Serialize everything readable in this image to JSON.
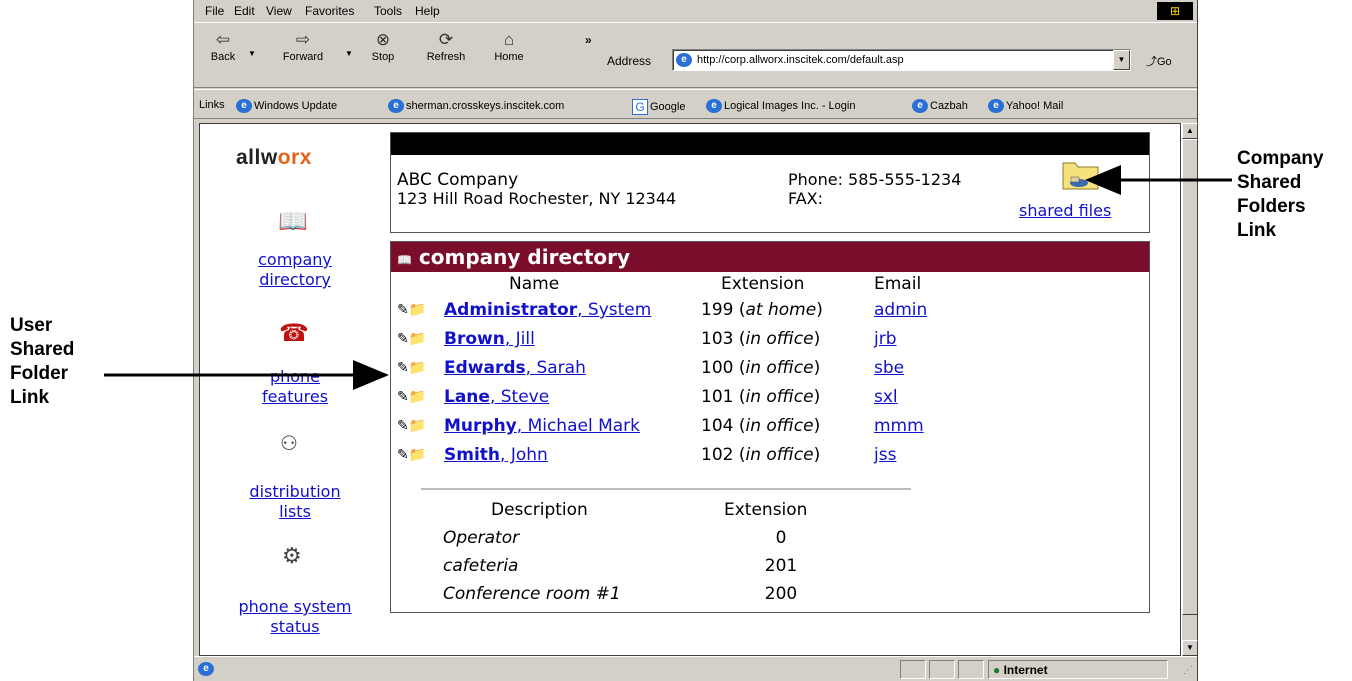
{
  "menu": [
    "File",
    "Edit",
    "View",
    "Favorites",
    "Tools",
    "Help"
  ],
  "toolbar": {
    "back": "Back",
    "forward": "Forward",
    "stop": "Stop",
    "refresh": "Refresh",
    "home": "Home",
    "chevron": "»",
    "address_label": "Address",
    "address_value": "http://corp.allworx.inscitek.com/default.asp",
    "go": "Go"
  },
  "links": {
    "label": "Links",
    "items": [
      "Windows Update",
      "sherman.crosskeys.inscitek.com",
      "Google",
      "Logical Images Inc. - Login",
      "Cazbah",
      "Yahoo! Mail"
    ]
  },
  "sidebar": {
    "logo": {
      "part1": "allw",
      "part2": "orx"
    },
    "company_directory": [
      "company",
      "directory"
    ],
    "phone_features": [
      "phone",
      "features"
    ],
    "distribution_lists": [
      "distribution",
      "lists"
    ],
    "phone_system_status": [
      "phone system",
      "status"
    ]
  },
  "company": {
    "name": "ABC Company",
    "address": "123 Hill Road Rochester, NY 12344",
    "phone": "Phone: 585-555-1234",
    "fax": "FAX:",
    "shared_files": "shared files"
  },
  "directory": {
    "title": "company directory",
    "col_name": "Name",
    "col_extension": "Extension",
    "col_email": "Email",
    "rows": [
      {
        "last": "Administrator",
        "first": ", System",
        "ext": "199",
        "status": "at home",
        "email": "admin"
      },
      {
        "last": "Brown",
        "first": ", Jill",
        "ext": "103",
        "status": "in office",
        "email": "jrb"
      },
      {
        "last": "Edwards",
        "first": ", Sarah",
        "ext": "100",
        "status": "in office",
        "email": "sbe"
      },
      {
        "last": "Lane",
        "first": ", Steve",
        "ext": "101",
        "status": "in office",
        "email": "sxl"
      },
      {
        "last": "Murphy",
        "first": ", Michael Mark",
        "ext": "104",
        "status": "in office",
        "email": "mmm"
      },
      {
        "last": "Smith",
        "first": ", John",
        "ext": "102",
        "status": "in office",
        "email": "jss"
      }
    ],
    "desc_header": "Description",
    "desc_ext_header": "Extension",
    "descriptions": [
      {
        "desc": "Operator",
        "ext": "0"
      },
      {
        "desc": "cafeteria",
        "ext": "201"
      },
      {
        "desc": "Conference room #1",
        "ext": "200"
      }
    ]
  },
  "status_bar": {
    "zone": "Internet"
  },
  "annotations": {
    "company_shared": "Company Shared Folders Link",
    "user_shared": "User Shared Folder Link"
  }
}
